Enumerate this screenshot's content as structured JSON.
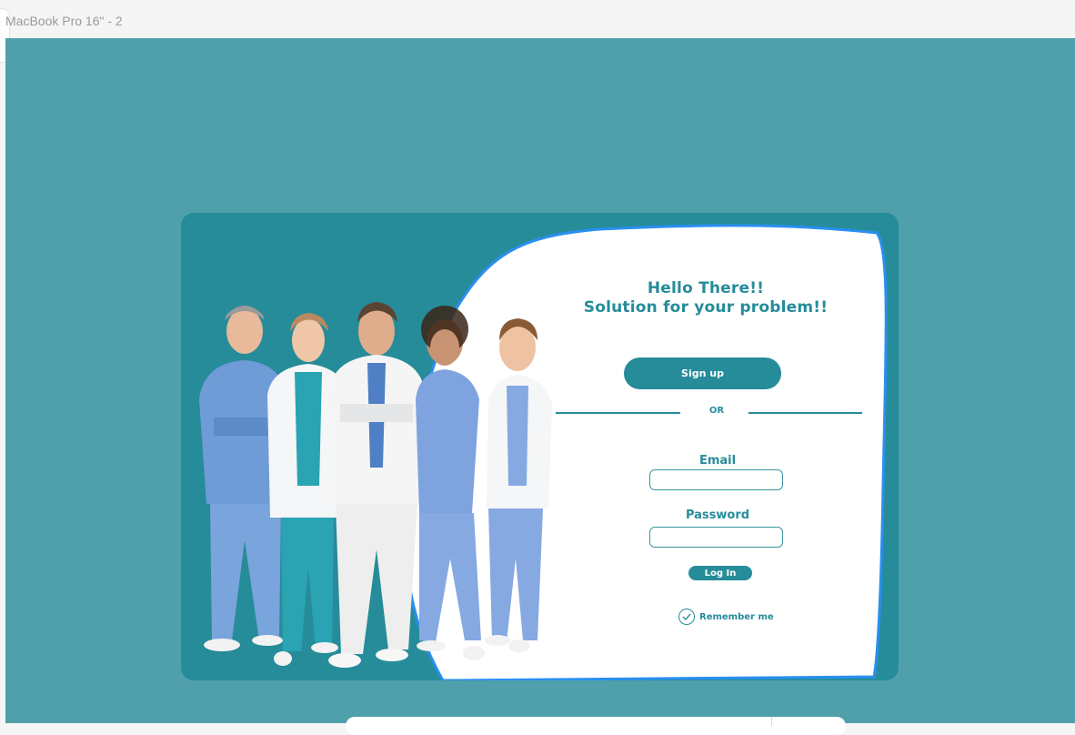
{
  "frame": {
    "label": "MacBook Pro 16\" - 2"
  },
  "colors": {
    "canvas": "#50a0ab",
    "card": "#268c99",
    "accent": "#268c99",
    "panel": "#ffffff",
    "panel_outline": "#2a8ff0"
  },
  "hero": {
    "title_line1": "Hello There!!",
    "title_line2": "Solution for your problem!!"
  },
  "signup": {
    "label": "Sign up"
  },
  "divider": {
    "text": "OR"
  },
  "form": {
    "email_label": "Email",
    "email_value": "",
    "password_label": "Password",
    "password_value": "",
    "login_label": "Log In",
    "remember_label": "Remember me",
    "remember_checked": true
  },
  "image": {
    "subject": "group of five medical staff in scrubs and white coats",
    "icon": "doctors-group-photo"
  },
  "icons": {
    "remember": "check-icon"
  }
}
